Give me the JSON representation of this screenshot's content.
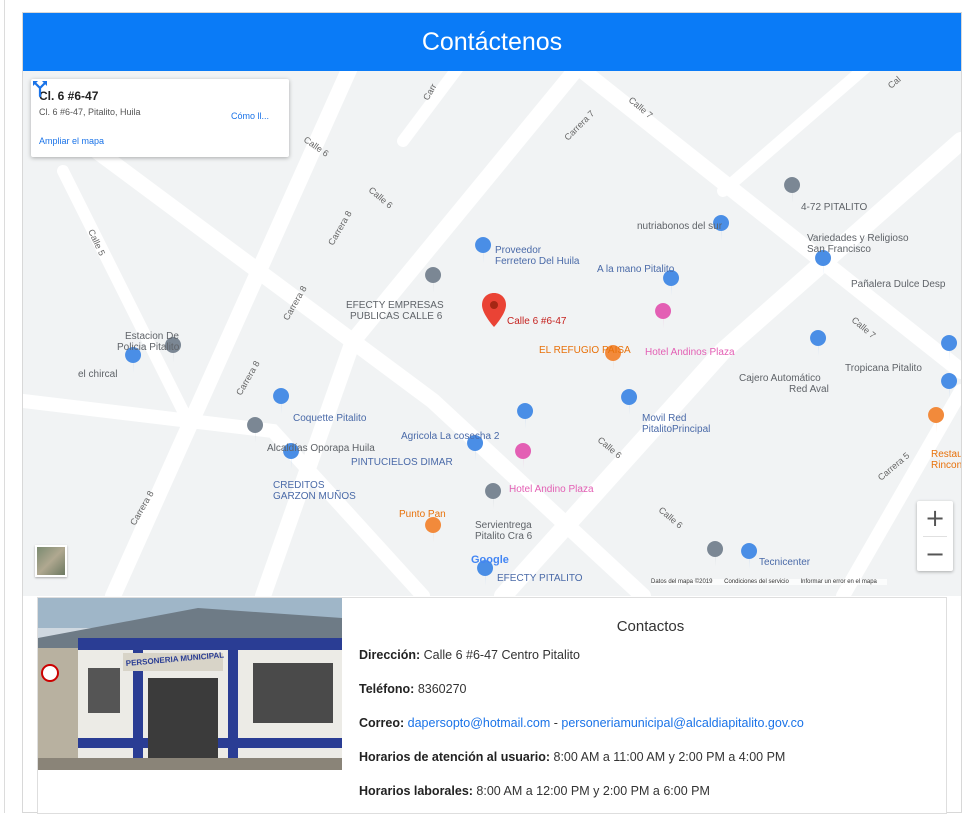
{
  "header": {
    "title": "Contáctenos"
  },
  "map": {
    "info_card": {
      "title": "Cl. 6 #6-47",
      "address": "Cl. 6 #6-47, Pitalito, Huila",
      "directions_label": "Cómo ll...",
      "enlarge_link": "Ampliar el mapa"
    },
    "marker_label": "Calle 6 #6-47",
    "street_labels": {
      "carrera7": "Carrera 7",
      "calle7_top": "Calle 7",
      "calle6_a": "Calle 6",
      "calle6_b": "Calle 6",
      "carrera8_a": "Carrera 8",
      "carrera8_b": "Carrera 8",
      "carrera8_c": "Carrera 8",
      "carrera8_d": "Carrera 8",
      "calle5": "Calle 5",
      "calle7_right": "Calle 7",
      "carrera5": "Carrera 5",
      "calle6_c": "Calle 6",
      "calle6_d": "Calle 6",
      "carr_top": "Carr",
      "cal_top_right": "Cal"
    },
    "places": [
      {
        "id": "472",
        "label": "4-72 PITALITO"
      },
      {
        "id": "nutria",
        "label": "nutriabonos del sur"
      },
      {
        "id": "variedades1",
        "label": "Variedades y Religioso"
      },
      {
        "id": "variedades2",
        "label": "San Francisco"
      },
      {
        "id": "panalera",
        "label": "Pañalera Dulce Desp"
      },
      {
        "id": "proveedor1",
        "label": "Proveedor"
      },
      {
        "id": "proveedor2",
        "label": "Ferretero Del Huila"
      },
      {
        "id": "alamano",
        "label": "A la mano Pitalito"
      },
      {
        "id": "efecty1",
        "label": "EFECTY EMPRESAS"
      },
      {
        "id": "efecty2",
        "label": "PUBLICAS CALLE 6"
      },
      {
        "id": "refugio",
        "label": "EL REFUGIO PAISA"
      },
      {
        "id": "hotelandinos",
        "label": "Hotel Andinos Plaza"
      },
      {
        "id": "cajero1",
        "label": "Cajero Automático"
      },
      {
        "id": "cajero2",
        "label": "Red Aval"
      },
      {
        "id": "tropicana",
        "label": "Tropicana Pitalito"
      },
      {
        "id": "estacion1",
        "label": "Estacion De"
      },
      {
        "id": "estacion2",
        "label": "Policia Pitalito"
      },
      {
        "id": "chircal",
        "label": "el chircal"
      },
      {
        "id": "coquette",
        "label": "Coquette Pitalito"
      },
      {
        "id": "movil1",
        "label": "Movil Red"
      },
      {
        "id": "movil2",
        "label": "PitalitoPrincipal"
      },
      {
        "id": "agricola",
        "label": "Agricola La cosecha 2"
      },
      {
        "id": "alcaldias",
        "label": "Alcaldías Oporapa Huila"
      },
      {
        "id": "pintucielos",
        "label": "PINTUCIELOS DIMAR"
      },
      {
        "id": "creditos1",
        "label": "CREDITOS"
      },
      {
        "id": "creditos2",
        "label": "GARZON MUÑOS"
      },
      {
        "id": "hotelandino",
        "label": "Hotel Andino Plaza"
      },
      {
        "id": "puntopan",
        "label": "Punto Pan"
      },
      {
        "id": "servi1",
        "label": "Servientrega"
      },
      {
        "id": "servi2",
        "label": "Pitalito Cra 6"
      },
      {
        "id": "restaura1",
        "label": "Restaura"
      },
      {
        "id": "restaura2",
        "label": "Rincon M"
      },
      {
        "id": "tecnicenter",
        "label": "Tecnicenter"
      },
      {
        "id": "efectypitalito",
        "label": "EFECTY PITALITO"
      }
    ],
    "google_logo": "Google",
    "attribution": {
      "data": "Datos del mapa ©2019",
      "terms": "Condiciones del servicio",
      "report": "Informar un error en el mapa"
    },
    "zoom_in": "+",
    "zoom_out": "−",
    "photo_sign": "PERSONERIA MUNICIPAL"
  },
  "contacts": {
    "title": "Contactos",
    "direccion_label": "Dirección:",
    "direccion_value": "Calle 6 #6-47 Centro Pitalito",
    "telefono_label": "Teléfono:",
    "telefono_value": "8360270",
    "correo_label": "Correo:",
    "correo_email1": "dapersopto@hotmail.com",
    "correo_sep": " - ",
    "correo_email2": "personeriamunicipal@alcaldiapitalito.gov.co",
    "horarios_atencion_label": "Horarios de atención al usuario:",
    "horarios_atencion_value": "8:00 AM a 11:00 AM y 2:00 PM a 4:00 PM",
    "horarios_laborales_label": "Horarios laborales:",
    "horarios_laborales_value": "8:00 AM a 12:00 PM y 2:00 PM a 6:00 PM"
  },
  "colors": {
    "header_bg": "#0a7bf7",
    "link": "#1a73e8",
    "poi_blue": "#4a8ee6",
    "poi_orange": "#f28a3b",
    "poi_pink": "#e35fb4",
    "marker_red": "#ea4335"
  }
}
